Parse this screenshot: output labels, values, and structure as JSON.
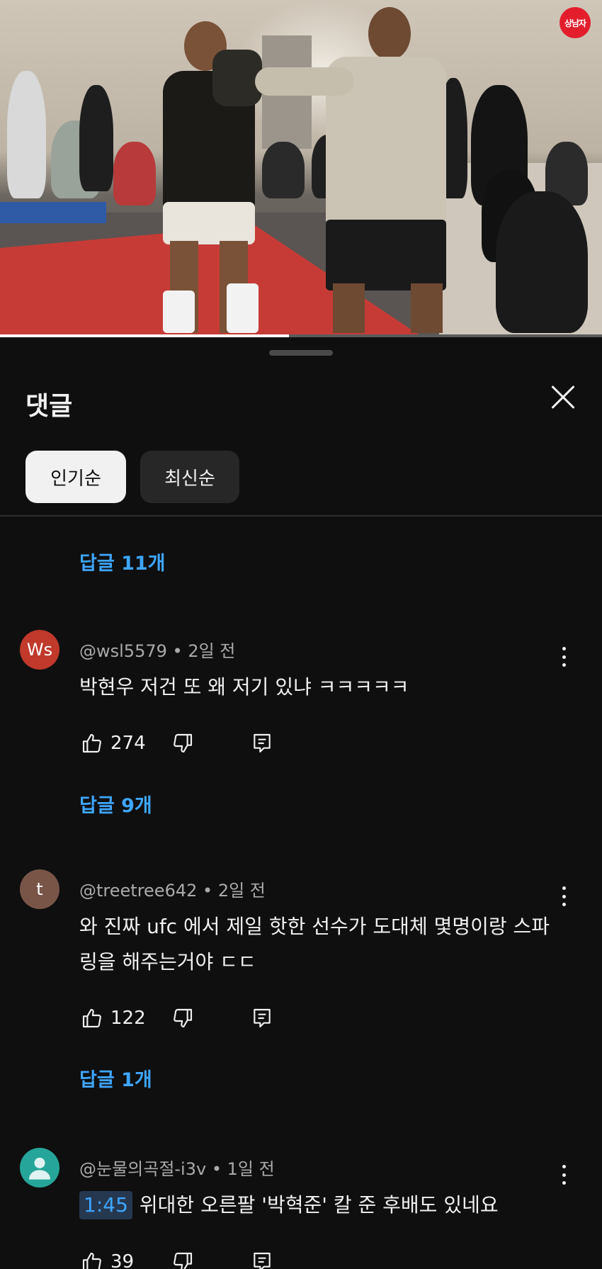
{
  "video": {
    "channel_badge": "상남자",
    "progress_fraction": 0.48
  },
  "panel": {
    "title": "댓글",
    "sort_chips": [
      "인기순",
      "최신순"
    ]
  },
  "replies": {
    "top": "답글 11개"
  },
  "comments": [
    {
      "avatar_text": "Ws",
      "avatar_color": "#c0392b",
      "author": "@wsl5579",
      "age": "2일 전",
      "text": "박현우 저건 또 왜 저기 있냐 ㅋㅋㅋㅋㅋ",
      "likes": "274",
      "replies_label": "답글 9개"
    },
    {
      "avatar_text": "t",
      "avatar_color": "#795548",
      "author": "@treetree642",
      "age": "2일 전",
      "text": "와 진짜 ufc 에서 제일 핫한 선수가 도대체 몇명이랑 스파링을 해주는거야 ㄷㄷ",
      "likes": "122",
      "replies_label": "답글 1개"
    },
    {
      "avatar_text": "",
      "avatar_color": "#26a69a",
      "author": "@눈물의곡절-i3v",
      "age": "1일 전",
      "timestamp": "1:45",
      "text": "위대한 오른팔 '박혁준' 칼 준 후배도 있네요",
      "likes": "39"
    }
  ],
  "meta_separator": "•",
  "icons": {
    "close": "close-icon",
    "like": "thumbs-up-icon",
    "dislike": "thumbs-down-icon",
    "reply": "reply-icon",
    "more": "more-vert-icon",
    "avatar_default": "person-icon"
  },
  "colors": {
    "background": "#0f0f0f",
    "link_blue": "#3ea6ff",
    "chip_active": "#f1f1f1",
    "chip_inactive": "#272727",
    "badge_red": "#e31d2c"
  }
}
